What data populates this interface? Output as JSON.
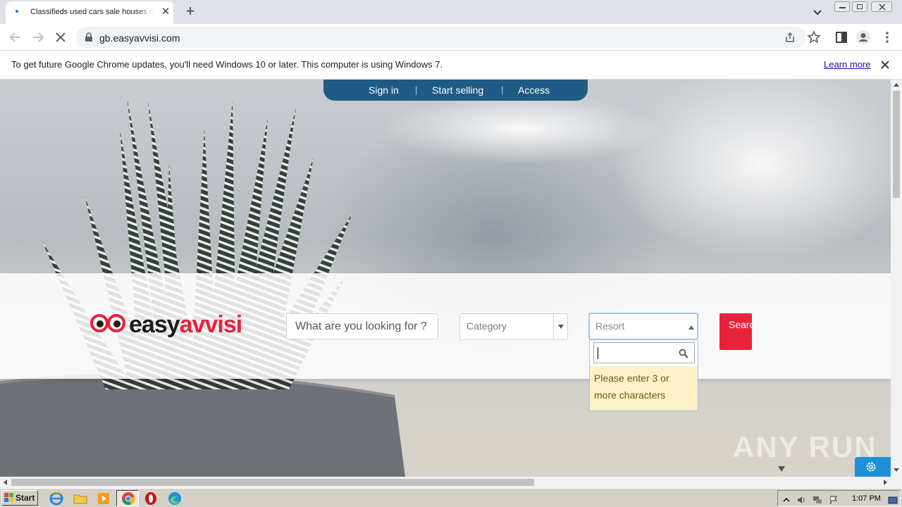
{
  "browser": {
    "tab_title": "Classifieds used cars sale houses rent",
    "new_tab_symbol": "+",
    "close_symbol": "✕",
    "url": "gb.easyavvisi.com"
  },
  "infobar": {
    "message": "To get future Google Chrome updates, you'll need Windows 10 or later. This computer is using Windows 7.",
    "learn_more": "Learn more"
  },
  "site": {
    "nav": [
      "Sign in",
      "Start selling",
      "Access"
    ],
    "nav_separator": "|",
    "logo": {
      "part1": "easy",
      "part2": "avvisi"
    },
    "search_placeholder": "What are you looking for ?",
    "category_placeholder": "Category",
    "resort_placeholder": "Resort",
    "resort_message": "Please enter 3 or more characters",
    "search_button": "Search for",
    "brand_color": "#e5233a",
    "nav_color": "#1e5b85"
  },
  "watermark": "ANY RUN",
  "taskbar": {
    "start_label": "Start",
    "clock": "1:07 PM",
    "apps": [
      "internet-explorer-icon",
      "folder-icon",
      "media-player-icon",
      "chrome-icon",
      "opera-icon",
      "edge-icon"
    ]
  }
}
